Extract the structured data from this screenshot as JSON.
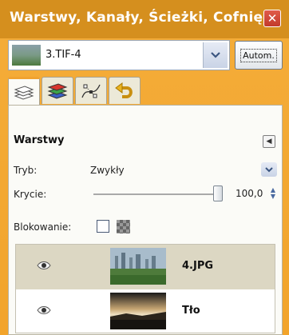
{
  "window": {
    "title": "Warstwy, Kanały, Ścieżki, Cofnię...",
    "close_symbol": "✕"
  },
  "image_selector": {
    "selected": "3.TIF-4",
    "auto_button": "Autom."
  },
  "tabs": [
    {
      "name": "layers",
      "icon": "layers-icon",
      "active": true
    },
    {
      "name": "channels",
      "icon": "channels-icon",
      "active": false
    },
    {
      "name": "paths",
      "icon": "paths-icon",
      "active": false
    },
    {
      "name": "undo",
      "icon": "undo-icon",
      "active": false
    }
  ],
  "panel": {
    "title": "Warstwy",
    "mode_label": "Tryb:",
    "mode_value": "Zwykły",
    "opacity_label": "Krycie:",
    "opacity_value": "100,0",
    "lock_label": "Blokowanie:"
  },
  "layers": [
    {
      "name": "4.JPG",
      "visible": true,
      "selected": true
    },
    {
      "name": "Tło",
      "visible": true,
      "selected": false
    }
  ],
  "colors": {
    "frame": "#f2a42b",
    "selection": "#dcd7c3"
  }
}
